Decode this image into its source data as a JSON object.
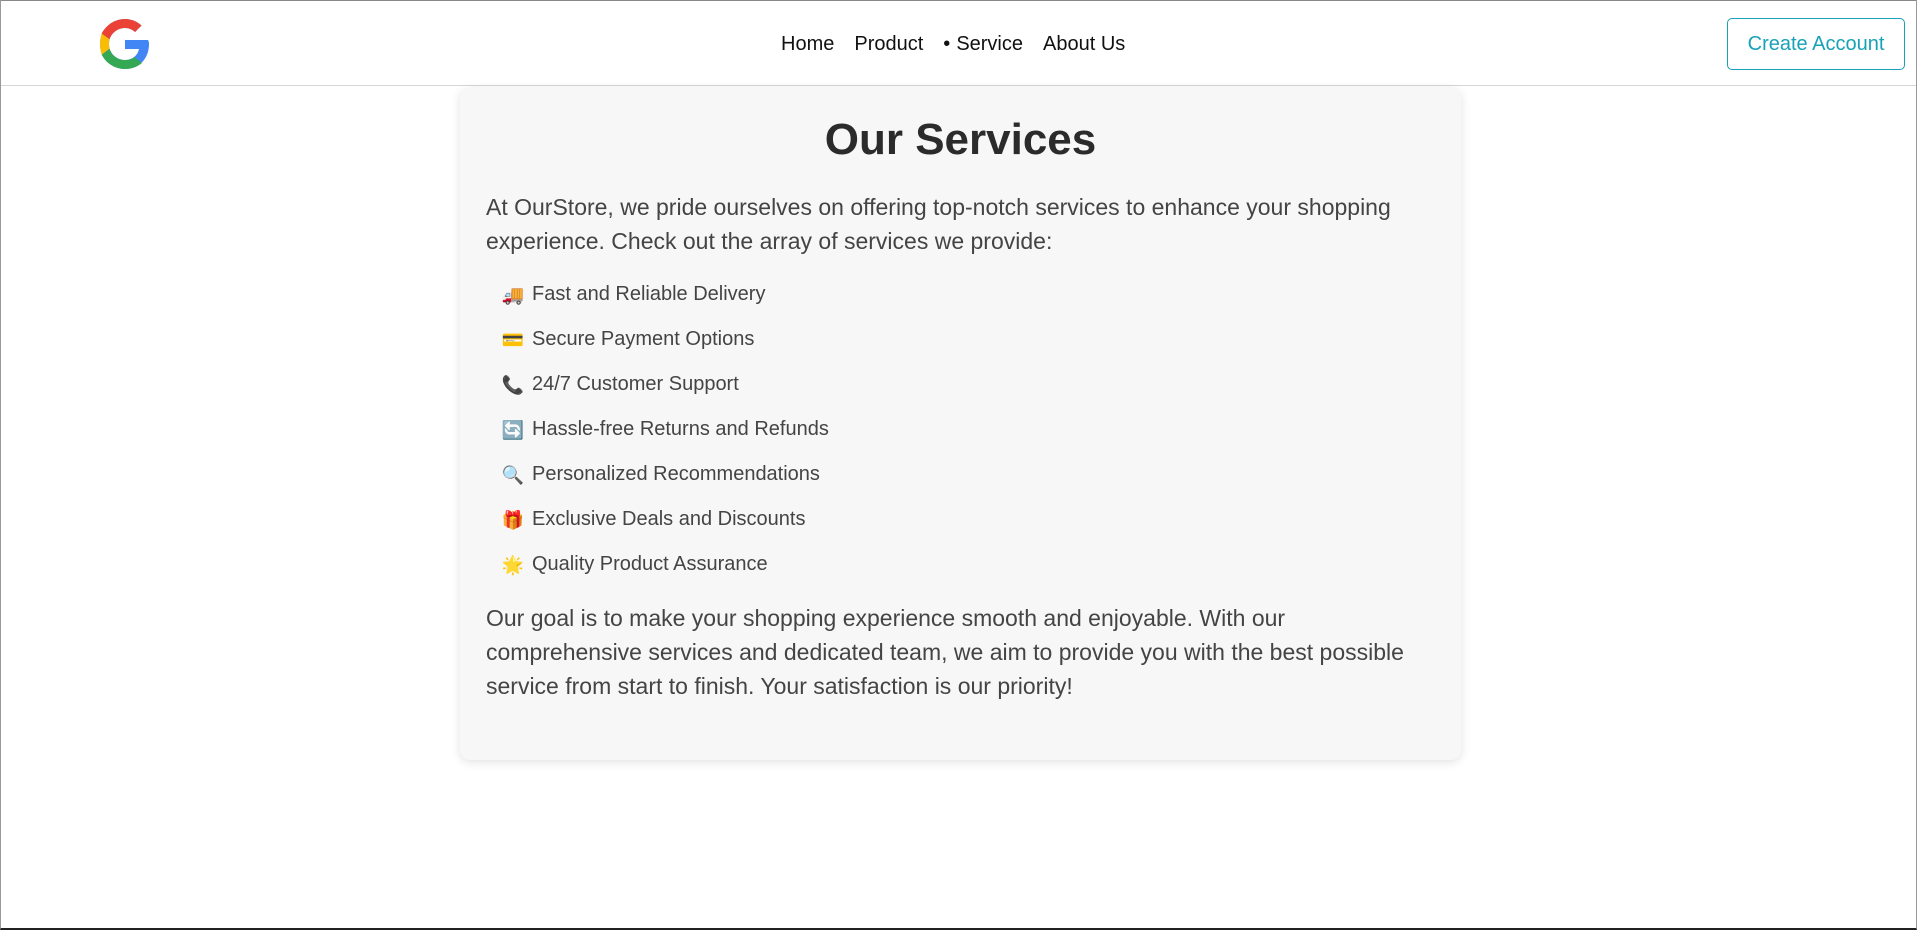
{
  "header": {
    "logo_icon": "google-g-logo-icon",
    "nav": [
      {
        "label": "Home",
        "active": false
      },
      {
        "label": "Product",
        "active": false
      },
      {
        "label": "Service",
        "active": true
      },
      {
        "label": "About Us",
        "active": false
      }
    ],
    "active_marker": "•",
    "cta_label": "Create Account",
    "accent_color": "#17a2b8"
  },
  "main": {
    "title": "Our Services",
    "intro": "At OurStore, we pride ourselves on offering top-notch services to enhance your shopping experience. Check out the array of services we provide:",
    "services": [
      {
        "icon": "truck-icon",
        "glyph": "🚚",
        "label": "Fast and Reliable Delivery"
      },
      {
        "icon": "credit-card-icon",
        "glyph": "💳",
        "label": "Secure Payment Options"
      },
      {
        "icon": "phone-icon",
        "glyph": "📞",
        "label": "24/7 Customer Support"
      },
      {
        "icon": "refresh-icon",
        "glyph": "🔄",
        "label": "Hassle-free Returns and Refunds"
      },
      {
        "icon": "magnifier-icon",
        "glyph": "🔍",
        "label": "Personalized Recommendations"
      },
      {
        "icon": "gift-icon",
        "glyph": "🎁",
        "label": "Exclusive Deals and Discounts"
      },
      {
        "icon": "star-icon",
        "glyph": "🌟",
        "label": "Quality Product Assurance"
      }
    ],
    "outro": "Our goal is to make your shopping experience smooth and enjoyable. With our comprehensive services and dedicated team, we aim to provide you with the best possible service from start to finish. Your satisfaction is our priority!"
  }
}
